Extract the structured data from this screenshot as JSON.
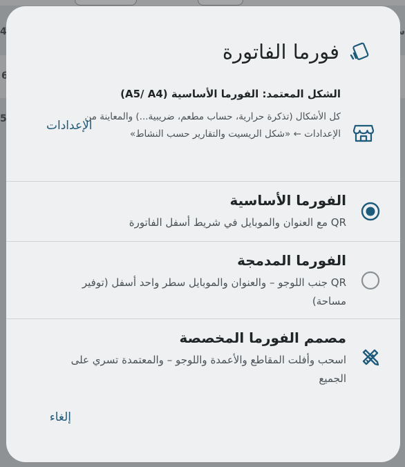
{
  "background": {
    "edge_left_top": "4",
    "edge_left_mid": "6",
    "edge_left_low": "5",
    "edge_right_top": "س"
  },
  "dialog": {
    "title": "فورما الفاتورة",
    "header_icon": "receipt-tilted-icon",
    "info": {
      "icon": "store-icon",
      "title": "الشكل المعتمد: الفورما الأساسية (A5/ A4)",
      "description": "كل الأشكال (تذكرة حرارية، حساب مطعم، ضريبية...) والمعاينة من الإعدادات ← «شكل الريسيت والتقارير حسب النشاط»",
      "settings_label": "الإعدادات"
    },
    "options": [
      {
        "title": "الفورما الأساسية",
        "description": "QR مع العنوان والموبايل في شريط أسفل الفاتورة",
        "selected": true,
        "icon": "radio-selected-icon"
      },
      {
        "title": "الفورما المدمجة",
        "description": "QR جنب اللوجو – والعنوان والموبايل سطر واحد أسفل (توفير مساحة)",
        "selected": false,
        "icon": "radio-unselected-icon"
      },
      {
        "title": "مصمم الفورما المخصصة",
        "description": "اسحب وأفلت المقاطع والأعمدة واللوجو – والمعتمدة تسري على الجميع",
        "icon": "design-tools-icon"
      }
    ],
    "cancel_label": "إلغاء"
  },
  "colors": {
    "accent": "#1e5a7a",
    "dialog_bg": "#eef0f1",
    "scrim": "#8f9294"
  }
}
